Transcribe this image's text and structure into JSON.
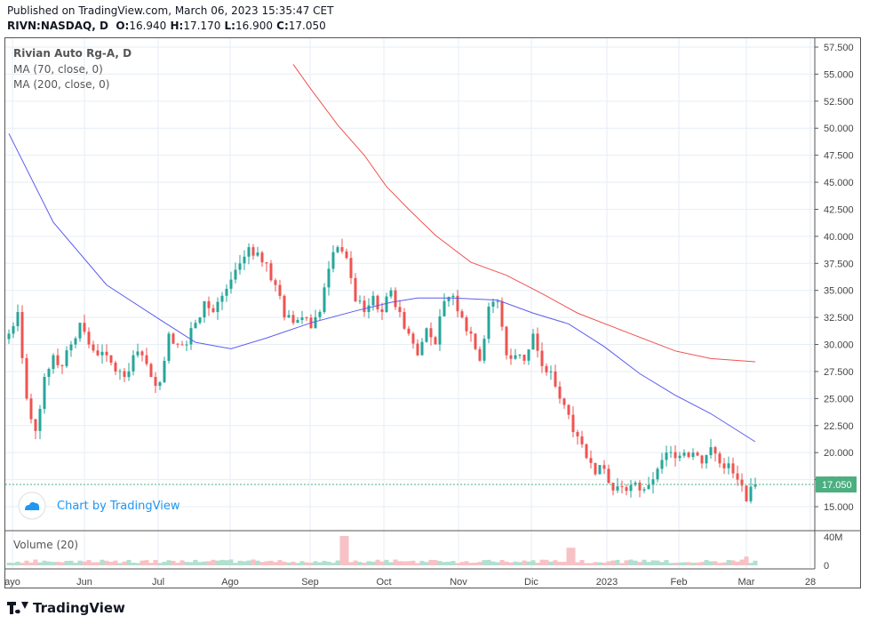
{
  "header": {
    "published": "Published on TradingView.com, March 06, 2023 15:35:47 CET",
    "symbol": "RIVN:NASDAQ, D",
    "o_label": "O:",
    "o": "16.940",
    "h_label": "H:",
    "h": "17.170",
    "l_label": "L:",
    "l": "16.900",
    "c_label": "C:",
    "c": "17.050"
  },
  "legend": {
    "title": "Rivian Auto Rg-A, D",
    "ma70": "MA (70, close, 0)",
    "ma200": "MA (200, close, 0)",
    "volume": "Volume (20)"
  },
  "watermark": "Chart by TradingView",
  "brand": "TradingView",
  "colors": {
    "up": "#26a69a",
    "down": "#ef5350",
    "ma70": "#5b5bef",
    "ma200": "#ef5350",
    "last": "#4caf81"
  },
  "chart_data": {
    "type": "candlestick",
    "ylim": [
      13.5,
      58.5
    ],
    "y_ticks": [
      "15.000",
      "17.500",
      "20.000",
      "22.500",
      "25.000",
      "27.500",
      "30.000",
      "32.500",
      "35.000",
      "37.500",
      "40.000",
      "42.500",
      "45.000",
      "47.500",
      "50.000",
      "52.500",
      "55.000",
      "57.500"
    ],
    "x_ticks": [
      {
        "label": "ayo",
        "at": 0.4
      },
      {
        "label": "Jun",
        "at": 8.5
      },
      {
        "label": "Jul",
        "at": 16.8
      },
      {
        "label": "Ago",
        "at": 24.9
      },
      {
        "label": "Sep",
        "at": 33.9
      },
      {
        "label": "Oct",
        "at": 42.2
      },
      {
        "label": "Nov",
        "at": 50.6
      },
      {
        "label": "Dic",
        "at": 58.8
      },
      {
        "label": "2023",
        "at": 67.3
      },
      {
        "label": "Feb",
        "at": 75.4
      },
      {
        "label": "Mar",
        "at": 83
      },
      {
        "label": "28",
        "at": 90.2
      }
    ],
    "last_price": "17.050",
    "closes": [
      31,
      33,
      25,
      22,
      27,
      29,
      28,
      30,
      32,
      30,
      29,
      29,
      27.5,
      27,
      29,
      29,
      27,
      26.5,
      31,
      30,
      30,
      32,
      34,
      33,
      34.5,
      36,
      37.5,
      39,
      38.5,
      37.5,
      35.5,
      32.5,
      32,
      32.5,
      31.5,
      33,
      37,
      39,
      38,
      34,
      33,
      34.5,
      33,
      35,
      33,
      31,
      29,
      31.5,
      30,
      34,
      34.5,
      32.5,
      31,
      28.5,
      33.5,
      34,
      29,
      29,
      28.5,
      31,
      28,
      27.5,
      25,
      23.5,
      21.5,
      19.5,
      18,
      18.5,
      16.5,
      16.8,
      17,
      16.5,
      17,
      18.5,
      20,
      19.5,
      20,
      20,
      19,
      20.5,
      19,
      19,
      17.5,
      15.5,
      17.05
    ],
    "ma70": [
      [
        0,
        49.5
      ],
      [
        5,
        41.3
      ],
      [
        11,
        35.5
      ],
      [
        17,
        32.3
      ],
      [
        21,
        30.2
      ],
      [
        25,
        29.6
      ],
      [
        29,
        30.6
      ],
      [
        34,
        32
      ],
      [
        39,
        33.1
      ],
      [
        43,
        33.9
      ],
      [
        46,
        34.3
      ],
      [
        50,
        34.3
      ],
      [
        55,
        34.1
      ],
      [
        59,
        32.9
      ],
      [
        63,
        31.9
      ],
      [
        67,
        29.8
      ],
      [
        71,
        27.3
      ],
      [
        75,
        25.3
      ],
      [
        79,
        23.6
      ],
      [
        84,
        21
      ]
    ],
    "ma200": [
      [
        32,
        55.9
      ],
      [
        34,
        53.6
      ],
      [
        37,
        50.3
      ],
      [
        40,
        47.5
      ],
      [
        42.5,
        44.6
      ],
      [
        45,
        42.5
      ],
      [
        48,
        40.1
      ],
      [
        52,
        37.6
      ],
      [
        56,
        36.4
      ],
      [
        60,
        34.7
      ],
      [
        64,
        32.9
      ],
      [
        69,
        31.3
      ],
      [
        75,
        29.4
      ],
      [
        79,
        28.7
      ],
      [
        84,
        28.4
      ]
    ],
    "volume_ticks": [
      "40M",
      "0"
    ],
    "volume_max": 45,
    "volume_spikes": [
      [
        37.8,
        40
      ],
      [
        63.3,
        24
      ],
      [
        83,
        12
      ]
    ]
  }
}
